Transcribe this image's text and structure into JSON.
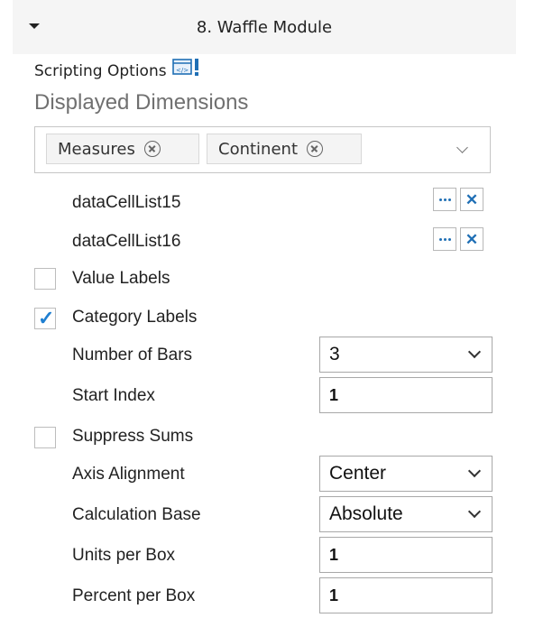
{
  "header": {
    "title": "8. Waffle Module"
  },
  "scripting": {
    "label": "Scripting Options"
  },
  "dimensions": {
    "title": "Displayed Dimensions",
    "chips": [
      "Measures",
      "Continent"
    ]
  },
  "data_cells": [
    "dataCellList15",
    "dataCellList16"
  ],
  "options": {
    "value_labels": {
      "label": "Value Labels",
      "checked": false
    },
    "category_labels": {
      "label": "Category Labels",
      "checked": true,
      "check_glyph": "✓"
    },
    "number_of_bars": {
      "label": "Number of Bars",
      "value": "3"
    },
    "start_index": {
      "label": "Start Index",
      "value": "1"
    },
    "suppress_sums": {
      "label": "Suppress Sums",
      "checked": false
    },
    "axis_alignment": {
      "label": "Axis Alignment",
      "value": "Center"
    },
    "calculation_base": {
      "label": "Calculation Base",
      "value": "Absolute"
    },
    "units_per_box": {
      "label": "Units per Box",
      "value": "1"
    },
    "percent_per_box": {
      "label": "Percent per Box",
      "value": "1"
    }
  },
  "colors": {
    "accent": "#1f6fb5",
    "check": "#1f7fd1",
    "header_bg": "#f5f5f5"
  }
}
